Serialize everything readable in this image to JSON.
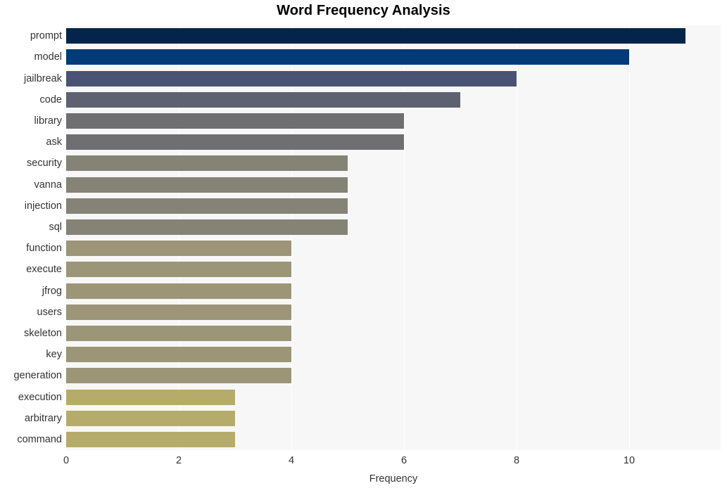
{
  "chart_data": {
    "type": "bar",
    "orientation": "horizontal",
    "title": "Word Frequency Analysis",
    "xlabel": "Frequency",
    "ylabel": "",
    "categories": [
      "prompt",
      "model",
      "jailbreak",
      "code",
      "library",
      "ask",
      "security",
      "vanna",
      "injection",
      "sql",
      "function",
      "execute",
      "jfrog",
      "users",
      "skeleton",
      "key",
      "generation",
      "execution",
      "arbitrary",
      "command"
    ],
    "values": [
      11,
      10,
      8,
      7,
      6,
      6,
      5,
      5,
      5,
      5,
      4,
      4,
      4,
      4,
      4,
      4,
      4,
      3,
      3,
      3
    ],
    "bar_colors": [
      "#04244c",
      "#033a79",
      "#4a5373",
      "#5e6170",
      "#6f6f71",
      "#6f6f71",
      "#848375",
      "#848375",
      "#848375",
      "#848375",
      "#9c9577",
      "#9c9577",
      "#9c9577",
      "#9c9577",
      "#9c9577",
      "#9c9577",
      "#9c9577",
      "#b5ac6c",
      "#b5ac6c",
      "#b5ac6c"
    ],
    "xticks": [
      0,
      2,
      4,
      6,
      8,
      10
    ],
    "xlim": [
      0,
      11.625
    ],
    "grid": "vertical",
    "legend": "none",
    "plot_background": "#f7f7f7",
    "figure_background": "#ffffff"
  }
}
